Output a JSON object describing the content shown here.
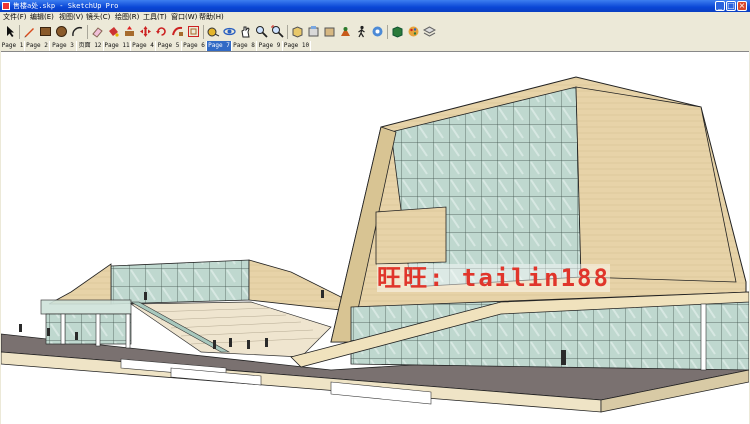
{
  "window": {
    "title": "售楼a处.skp - SketchUp Pro",
    "minimize": "_",
    "maximize": "□",
    "close": "×"
  },
  "menu": [
    "文件(F)",
    "编辑(E)",
    "视图(V)",
    "镜头(C)",
    "绘图(R)",
    "工具(T)",
    "窗口(W)",
    "帮助(H)"
  ],
  "toolbar": [
    "select-icon",
    "pencil-icon",
    "rectangle-icon",
    "circle-icon",
    "arc-icon",
    "eraser-icon",
    "paint-bucket-icon",
    "push-pull-icon",
    "move-icon",
    "rotate-icon",
    "follow-me-icon",
    "offset-icon",
    "tape-measure-icon",
    "dimension-icon",
    "protractor-icon",
    "text-icon",
    "axes-icon",
    "orbit-icon",
    "pan-icon",
    "zoom-icon",
    "zoom-extents-icon",
    "previous-view-icon",
    "section-plane-icon",
    "walk-icon",
    "look-around-icon",
    "position-camera-icon",
    "components-icon",
    "materials-icon",
    "layers-icon"
  ],
  "tabs": {
    "items": [
      "Page 1",
      "Page 2",
      "Page 3",
      "页面 12",
      "Page 11",
      "Page 4",
      "Page 5",
      "Page 6",
      "Page 7",
      "Page 8",
      "Page 9",
      "Page 10"
    ],
    "active": "Page 7"
  },
  "watermark": "旺旺: tailin188",
  "colors": {
    "titlebar": "#0a46d6",
    "active_tab": "#316ac5",
    "watermark": "#e0352b"
  }
}
